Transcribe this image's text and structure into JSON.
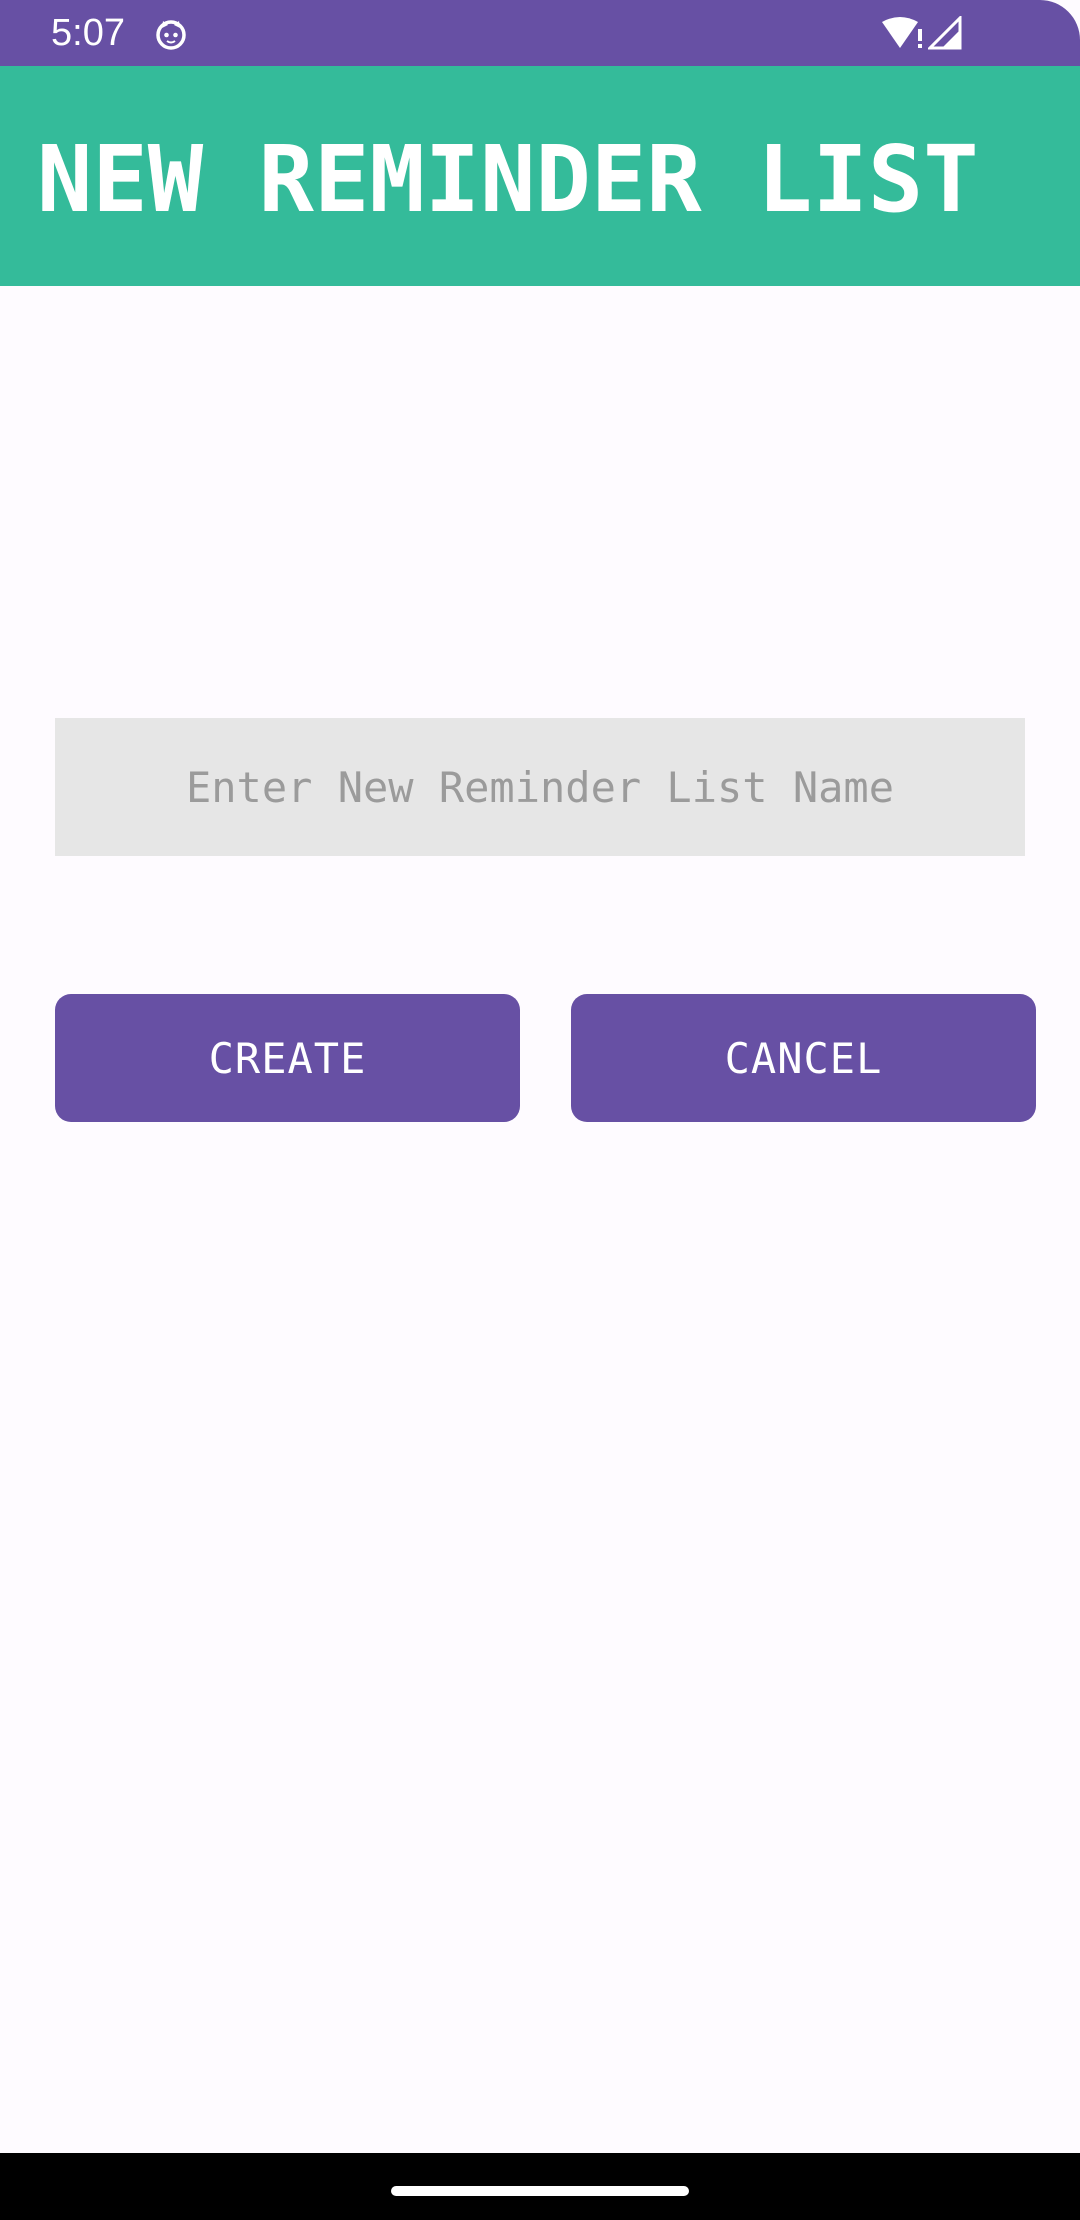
{
  "status_bar": {
    "time": "5:07",
    "app_icon": "cat-face-icon",
    "wifi_icon": "wifi-alert-icon",
    "signal_icon": "cell-signal-icon",
    "background_color": "#6750a4"
  },
  "app_bar": {
    "title": "NEW REMINDER LIST",
    "background_color": "#34bb9a"
  },
  "form": {
    "name_input": {
      "value": "",
      "placeholder": "Enter New Reminder List Name"
    },
    "create_label": "CREATE",
    "cancel_label": "CANCEL",
    "button_color": "#6750a4"
  },
  "nav_bar": {
    "handle": "gesture-handle"
  }
}
